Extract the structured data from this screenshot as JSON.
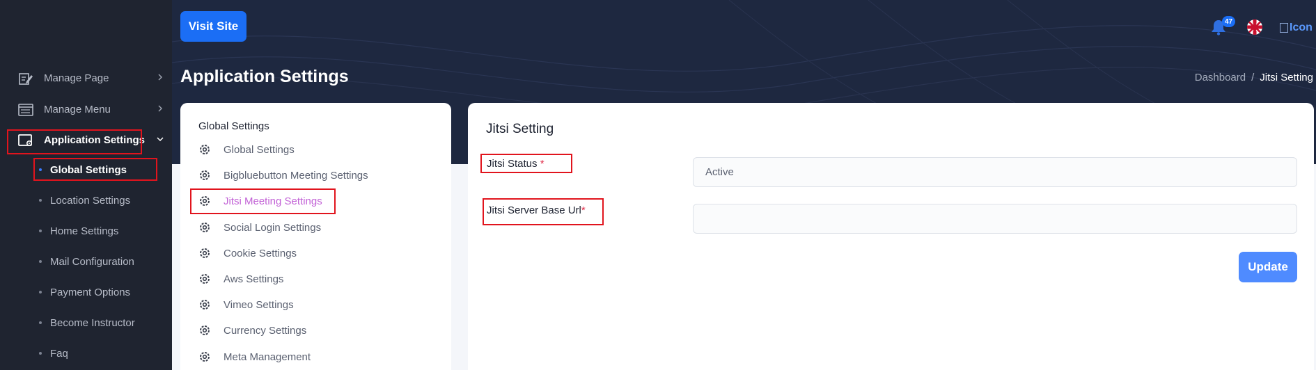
{
  "header": {
    "visit_site_label": "Visit Site",
    "page_title": "Application Settings",
    "notification_count": "47",
    "user_icon_alt": "Icon"
  },
  "breadcrumb": {
    "home": "Dashboard",
    "separator": "/",
    "current": "Jitsi Setting"
  },
  "sidebar": {
    "items": [
      {
        "label": "Manage Page"
      },
      {
        "label": "Manage Menu"
      },
      {
        "label": "Application Settings"
      }
    ],
    "sub_items": [
      {
        "label": "Global Settings"
      },
      {
        "label": "Location Settings"
      },
      {
        "label": "Home Settings"
      },
      {
        "label": "Mail Configuration"
      },
      {
        "label": "Payment Options"
      },
      {
        "label": "Become Instructor"
      },
      {
        "label": "Faq"
      }
    ]
  },
  "settings_menu": {
    "heading": "Global Settings",
    "links": [
      {
        "label": "Global Settings"
      },
      {
        "label": "Bigbluebutton Meeting Settings"
      },
      {
        "label": "Jitsi Meeting Settings"
      },
      {
        "label": "Social Login Settings"
      },
      {
        "label": "Cookie Settings"
      },
      {
        "label": "Aws Settings"
      },
      {
        "label": "Vimeo Settings"
      },
      {
        "label": "Currency Settings"
      },
      {
        "label": "Meta Management"
      }
    ]
  },
  "form": {
    "title": "Jitsi Setting",
    "status_label": "Jitsi Status",
    "status_required": "*",
    "status_value": "Active",
    "base_url_label": "Jitsi Server Base Url",
    "base_url_required": "*",
    "base_url_value": "",
    "update_label": "Update"
  },
  "colors": {
    "sidebar_bg": "#1f2430",
    "header_bg": "#1e2840",
    "primary": "#1b6ef5",
    "active_link": "#c262d6",
    "annotation": "#e1141d"
  }
}
